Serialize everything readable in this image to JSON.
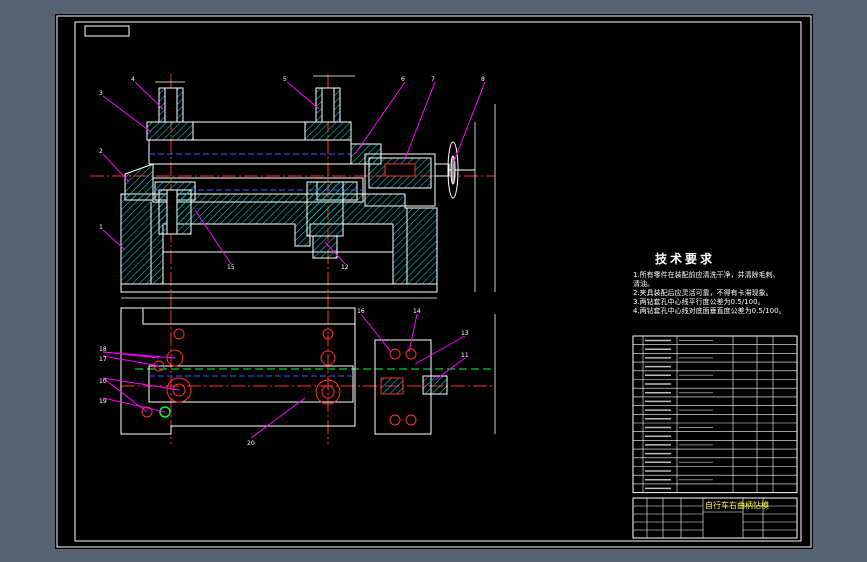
{
  "colors": {
    "canvas_background": "#56626f",
    "sheet_background": "#000000",
    "outline": "#ffffff",
    "centerline": "#ff3030",
    "leader": "#ff00ff",
    "hidden": "#3a5bff",
    "hatch": "#00c8c8",
    "dimension": "#ffffff",
    "title_text": "#ffffff",
    "green": "#00ff44"
  },
  "drawing": {
    "tech_requirements": {
      "heading": "技术要求",
      "lines": [
        "1.所有零件在装配前应清洗干净，并清除毛刺、",
        "清油。",
        "2.夹具装配后应灵活可靠，不得有卡滞现象。",
        "3.两钻套孔中心线平行度公差为0.5/100。",
        "4.两钻套孔中心线对底面垂直度公差为0.5/100。"
      ]
    },
    "title_block": {
      "name": "自行车右曲柄钻模"
    },
    "balloons_front": [
      "4",
      "5",
      "6",
      "7",
      "8",
      "3",
      "2",
      "1",
      "15",
      "12"
    ],
    "balloons_plan": [
      "16",
      "14",
      "18",
      "17",
      "10",
      "13",
      "11",
      "19",
      "20"
    ]
  }
}
